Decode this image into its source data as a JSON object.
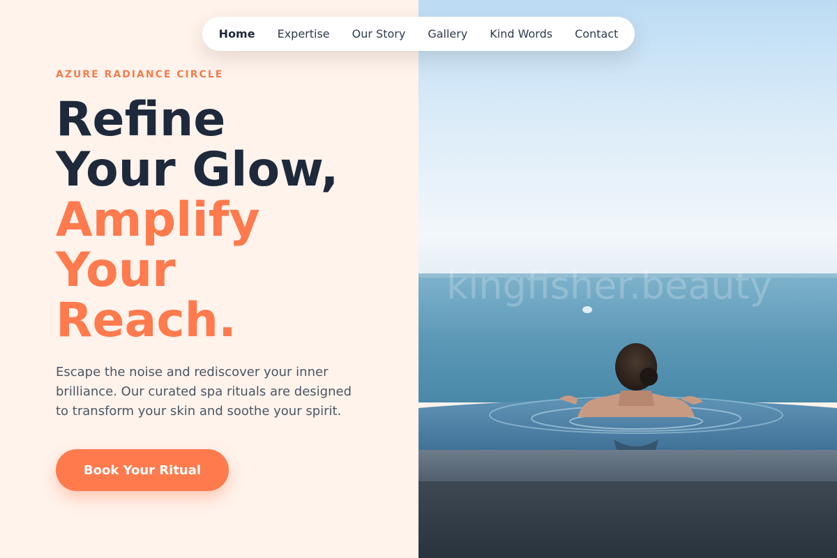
{
  "nav": {
    "items": [
      {
        "label": "Home",
        "active": true
      },
      {
        "label": "Expertise",
        "active": false
      },
      {
        "label": "Our Story",
        "active": false
      },
      {
        "label": "Gallery",
        "active": false
      },
      {
        "label": "Kind Words",
        "active": false
      },
      {
        "label": "Contact",
        "active": false
      }
    ]
  },
  "hero": {
    "eyebrow": "AZURE RADIANCE CIRCLE",
    "headline_dark": [
      "Refine",
      "Your Glow,"
    ],
    "headline_accent": [
      "Amplify",
      "Your",
      "Reach."
    ],
    "description": "Escape the noise and rediscover your inner brilliance. Our curated spa rituals are designed to transform your skin and soothe your spirit.",
    "cta_label": "Book Your Ritual"
  },
  "image": {
    "watermark": "kingfisher.beauty"
  },
  "colors": {
    "accent": "#ff7a4d",
    "dark_text": "#1e293b",
    "background": "#fff3ec"
  }
}
